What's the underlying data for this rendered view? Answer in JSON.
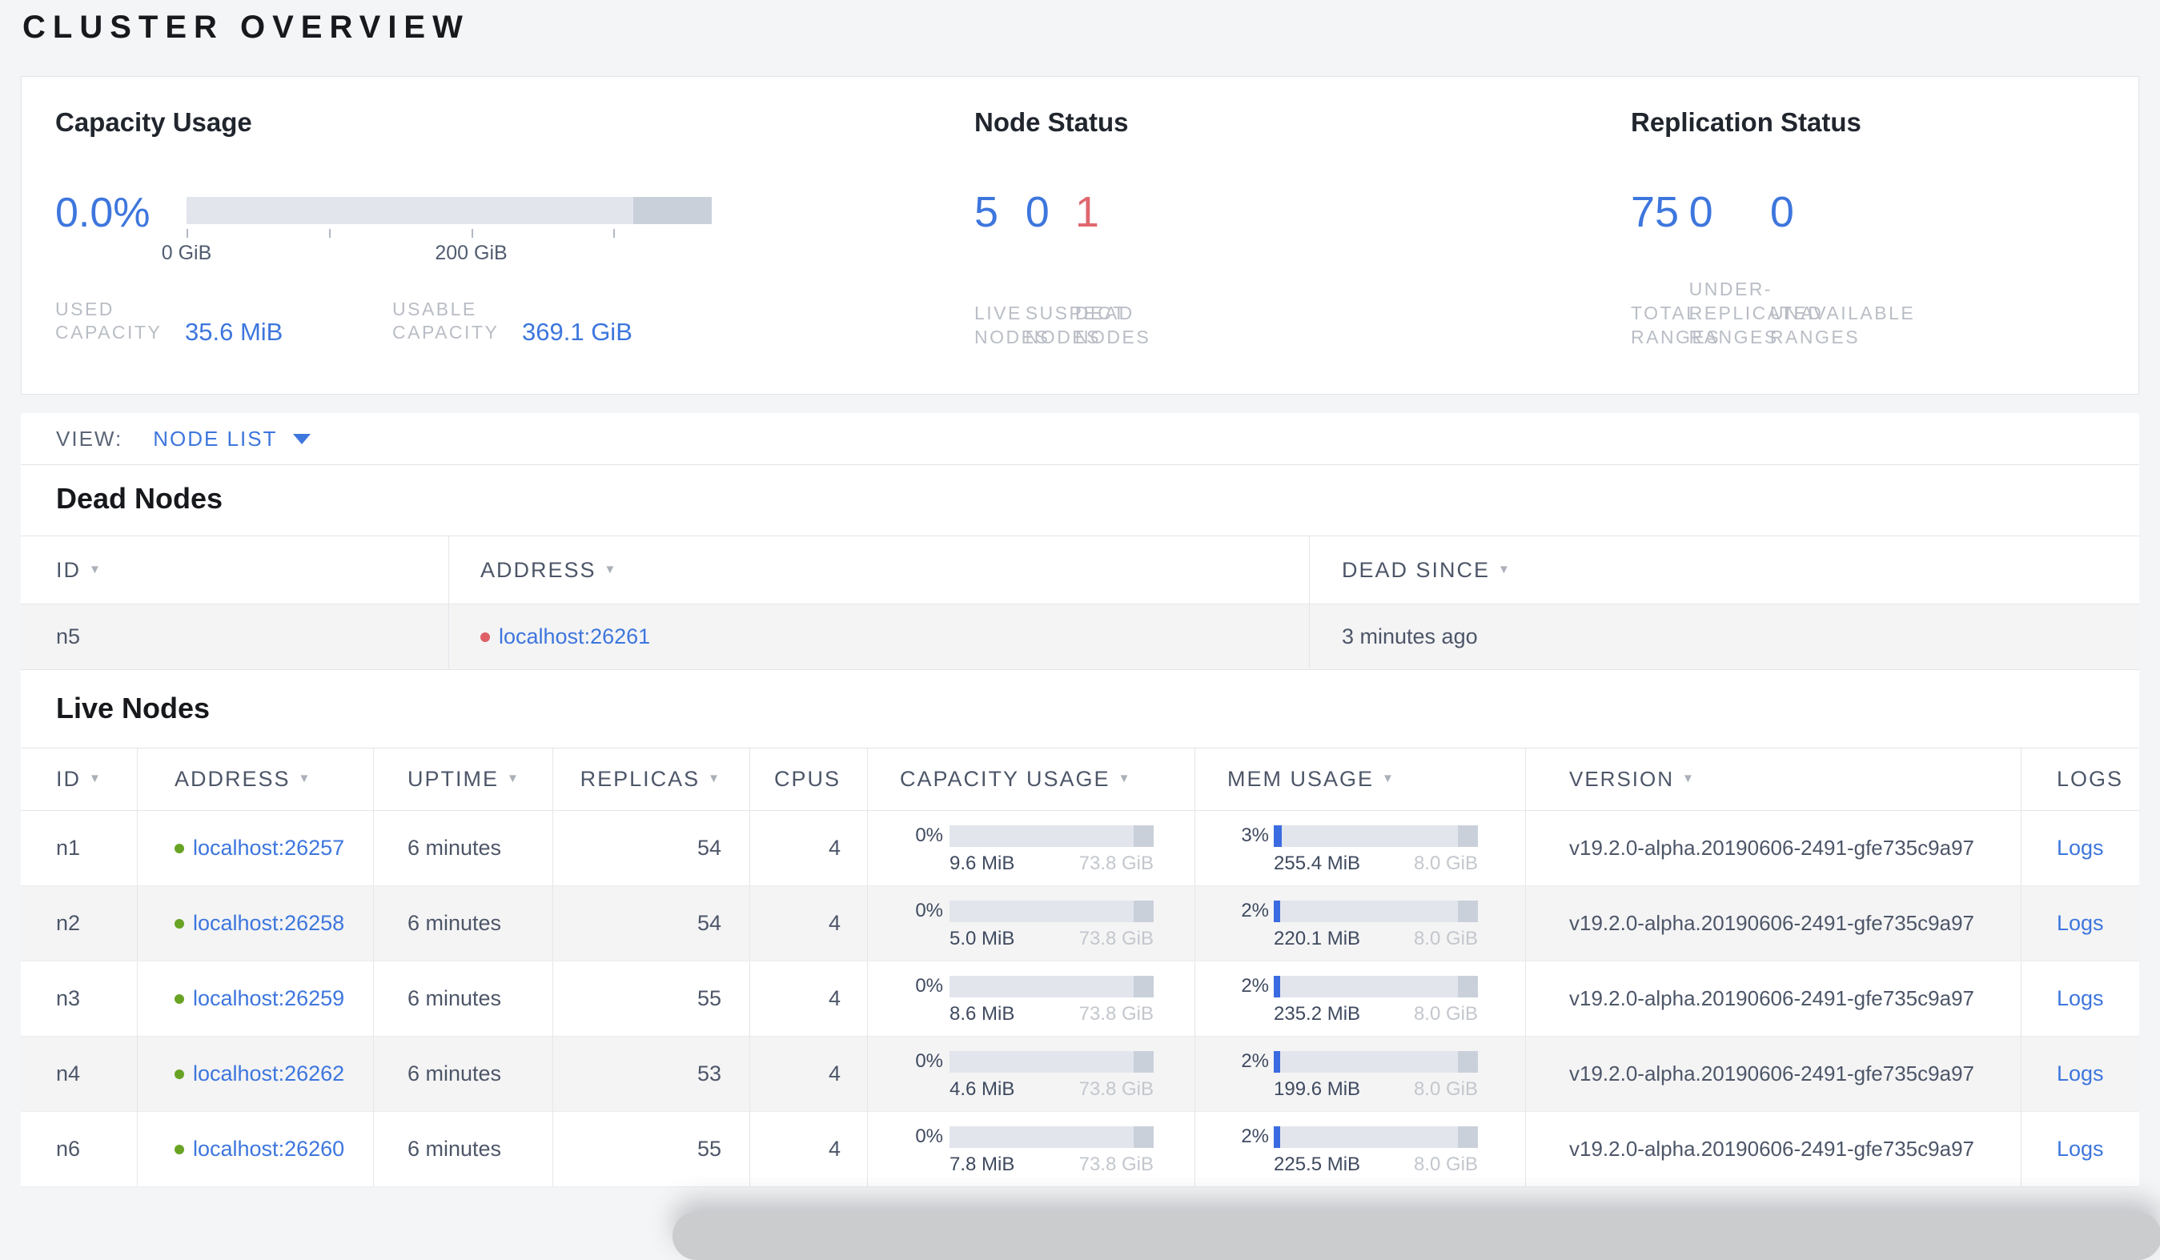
{
  "page": {
    "title": "CLUSTER OVERVIEW"
  },
  "summary": {
    "capacity_usage": {
      "title": "Capacity Usage",
      "percent": "0.0%",
      "bar": {
        "used_fill_pct": 0,
        "reserved_seg_pct": 15,
        "tick_labels": [
          "0 GiB",
          "",
          "200 GiB",
          ""
        ]
      },
      "stats": [
        {
          "label": "USED CAPACITY",
          "value": "35.6 MiB"
        },
        {
          "label": "USABLE CAPACITY",
          "value": "369.1 GiB"
        }
      ]
    },
    "node_status": {
      "title": "Node Status",
      "stats": [
        {
          "value": "5",
          "label": "LIVE NODES",
          "tone": "primary"
        },
        {
          "value": "0",
          "label": "SUSPECT NODES",
          "tone": "primary"
        },
        {
          "value": "1",
          "label": "DEAD NODES",
          "tone": "danger"
        }
      ]
    },
    "replication_status": {
      "title": "Replication Status",
      "stats": [
        {
          "value": "75",
          "label": "TOTAL RANGES",
          "tone": "primary"
        },
        {
          "value": "0",
          "label": "UNDER-REPLICATED RANGES",
          "tone": "primary"
        },
        {
          "value": "0",
          "label": "UNAVAILABLE RANGES",
          "tone": "primary"
        }
      ]
    }
  },
  "view_bar": {
    "label": "VIEW:",
    "selected": "NODE LIST"
  },
  "dead_nodes": {
    "title": "Dead Nodes",
    "columns": [
      {
        "label": "ID",
        "sortable": true
      },
      {
        "label": "ADDRESS",
        "sortable": true
      },
      {
        "label": "DEAD SINCE",
        "sortable": true
      }
    ],
    "rows": [
      {
        "id": "n5",
        "address": "localhost:26261",
        "status": "dead",
        "dead_since": "3 minutes ago"
      }
    ]
  },
  "live_nodes": {
    "title": "Live Nodes",
    "columns": [
      {
        "label": "ID",
        "sortable": true
      },
      {
        "label": "ADDRESS",
        "sortable": true
      },
      {
        "label": "UPTIME",
        "sortable": true
      },
      {
        "label": "REPLICAS",
        "sortable": true
      },
      {
        "label": "CPUS",
        "sortable": false
      },
      {
        "label": "CAPACITY USAGE",
        "sortable": true
      },
      {
        "label": "MEM USAGE",
        "sortable": true
      },
      {
        "label": "VERSION",
        "sortable": true
      },
      {
        "label": "LOGS",
        "sortable": false
      }
    ],
    "rows": [
      {
        "id": "n1",
        "address": "localhost:26257",
        "status": "live",
        "uptime": "6 minutes",
        "replicas": "54",
        "cpus": "4",
        "capacity": {
          "pct": "0%",
          "used": "9.6 MiB",
          "total": "73.8 GiB",
          "fill_pct": 0
        },
        "mem": {
          "pct": "3%",
          "used": "255.4 MiB",
          "total": "8.0 GiB",
          "fill_pct": 4
        },
        "version": "v19.2.0-alpha.20190606-2491-gfe735c9a97",
        "logs": "Logs"
      },
      {
        "id": "n2",
        "address": "localhost:26258",
        "status": "live",
        "uptime": "6 minutes",
        "replicas": "54",
        "cpus": "4",
        "capacity": {
          "pct": "0%",
          "used": "5.0 MiB",
          "total": "73.8 GiB",
          "fill_pct": 0
        },
        "mem": {
          "pct": "2%",
          "used": "220.1 MiB",
          "total": "8.0 GiB",
          "fill_pct": 3
        },
        "version": "v19.2.0-alpha.20190606-2491-gfe735c9a97",
        "logs": "Logs"
      },
      {
        "id": "n3",
        "address": "localhost:26259",
        "status": "live",
        "uptime": "6 minutes",
        "replicas": "55",
        "cpus": "4",
        "capacity": {
          "pct": "0%",
          "used": "8.6 MiB",
          "total": "73.8 GiB",
          "fill_pct": 0
        },
        "mem": {
          "pct": "2%",
          "used": "235.2 MiB",
          "total": "8.0 GiB",
          "fill_pct": 3
        },
        "version": "v19.2.0-alpha.20190606-2491-gfe735c9a97",
        "logs": "Logs"
      },
      {
        "id": "n4",
        "address": "localhost:26262",
        "status": "live",
        "uptime": "6 minutes",
        "replicas": "53",
        "cpus": "4",
        "capacity": {
          "pct": "0%",
          "used": "4.6 MiB",
          "total": "73.8 GiB",
          "fill_pct": 0
        },
        "mem": {
          "pct": "2%",
          "used": "199.6 MiB",
          "total": "8.0 GiB",
          "fill_pct": 3
        },
        "version": "v19.2.0-alpha.20190606-2491-gfe735c9a97",
        "logs": "Logs"
      },
      {
        "id": "n6",
        "address": "localhost:26260",
        "status": "live",
        "uptime": "6 minutes",
        "replicas": "55",
        "cpus": "4",
        "capacity": {
          "pct": "0%",
          "used": "7.8 MiB",
          "total": "73.8 GiB",
          "fill_pct": 0
        },
        "mem": {
          "pct": "2%",
          "used": "225.5 MiB",
          "total": "8.0 GiB",
          "fill_pct": 3
        },
        "version": "v19.2.0-alpha.20190606-2491-gfe735c9a97",
        "logs": "Logs"
      }
    ]
  },
  "colors": {
    "accent_blue": "#3d76dd",
    "danger_red": "#e0686f",
    "live_green": "#68a324",
    "dead_dot_red": "#de5f66",
    "bar_track": "#e2e5ec",
    "bar_reserved": "#cad0da",
    "mem_fill_blue": "#3a6be0"
  }
}
